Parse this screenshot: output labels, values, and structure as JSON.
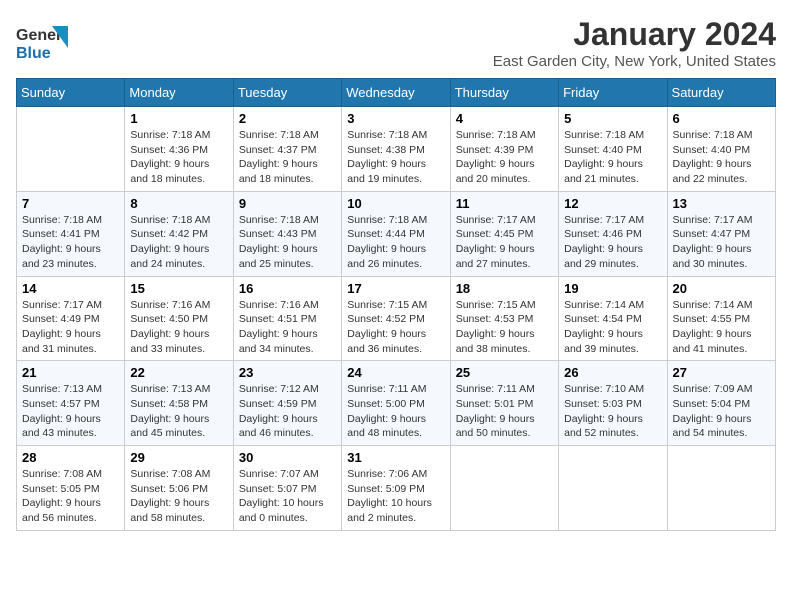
{
  "header": {
    "logo_general": "General",
    "logo_blue": "Blue",
    "title": "January 2024",
    "subtitle": "East Garden City, New York, United States"
  },
  "days_of_week": [
    "Sunday",
    "Monday",
    "Tuesday",
    "Wednesday",
    "Thursday",
    "Friday",
    "Saturday"
  ],
  "weeks": [
    [
      {
        "day": "",
        "sunrise": "",
        "sunset": "",
        "daylight": ""
      },
      {
        "day": "1",
        "sunrise": "Sunrise: 7:18 AM",
        "sunset": "Sunset: 4:36 PM",
        "daylight": "Daylight: 9 hours and 18 minutes."
      },
      {
        "day": "2",
        "sunrise": "Sunrise: 7:18 AM",
        "sunset": "Sunset: 4:37 PM",
        "daylight": "Daylight: 9 hours and 18 minutes."
      },
      {
        "day": "3",
        "sunrise": "Sunrise: 7:18 AM",
        "sunset": "Sunset: 4:38 PM",
        "daylight": "Daylight: 9 hours and 19 minutes."
      },
      {
        "day": "4",
        "sunrise": "Sunrise: 7:18 AM",
        "sunset": "Sunset: 4:39 PM",
        "daylight": "Daylight: 9 hours and 20 minutes."
      },
      {
        "day": "5",
        "sunrise": "Sunrise: 7:18 AM",
        "sunset": "Sunset: 4:40 PM",
        "daylight": "Daylight: 9 hours and 21 minutes."
      },
      {
        "day": "6",
        "sunrise": "Sunrise: 7:18 AM",
        "sunset": "Sunset: 4:40 PM",
        "daylight": "Daylight: 9 hours and 22 minutes."
      }
    ],
    [
      {
        "day": "7",
        "sunrise": "Sunrise: 7:18 AM",
        "sunset": "Sunset: 4:41 PM",
        "daylight": "Daylight: 9 hours and 23 minutes."
      },
      {
        "day": "8",
        "sunrise": "Sunrise: 7:18 AM",
        "sunset": "Sunset: 4:42 PM",
        "daylight": "Daylight: 9 hours and 24 minutes."
      },
      {
        "day": "9",
        "sunrise": "Sunrise: 7:18 AM",
        "sunset": "Sunset: 4:43 PM",
        "daylight": "Daylight: 9 hours and 25 minutes."
      },
      {
        "day": "10",
        "sunrise": "Sunrise: 7:18 AM",
        "sunset": "Sunset: 4:44 PM",
        "daylight": "Daylight: 9 hours and 26 minutes."
      },
      {
        "day": "11",
        "sunrise": "Sunrise: 7:17 AM",
        "sunset": "Sunset: 4:45 PM",
        "daylight": "Daylight: 9 hours and 27 minutes."
      },
      {
        "day": "12",
        "sunrise": "Sunrise: 7:17 AM",
        "sunset": "Sunset: 4:46 PM",
        "daylight": "Daylight: 9 hours and 29 minutes."
      },
      {
        "day": "13",
        "sunrise": "Sunrise: 7:17 AM",
        "sunset": "Sunset: 4:47 PM",
        "daylight": "Daylight: 9 hours and 30 minutes."
      }
    ],
    [
      {
        "day": "14",
        "sunrise": "Sunrise: 7:17 AM",
        "sunset": "Sunset: 4:49 PM",
        "daylight": "Daylight: 9 hours and 31 minutes."
      },
      {
        "day": "15",
        "sunrise": "Sunrise: 7:16 AM",
        "sunset": "Sunset: 4:50 PM",
        "daylight": "Daylight: 9 hours and 33 minutes."
      },
      {
        "day": "16",
        "sunrise": "Sunrise: 7:16 AM",
        "sunset": "Sunset: 4:51 PM",
        "daylight": "Daylight: 9 hours and 34 minutes."
      },
      {
        "day": "17",
        "sunrise": "Sunrise: 7:15 AM",
        "sunset": "Sunset: 4:52 PM",
        "daylight": "Daylight: 9 hours and 36 minutes."
      },
      {
        "day": "18",
        "sunrise": "Sunrise: 7:15 AM",
        "sunset": "Sunset: 4:53 PM",
        "daylight": "Daylight: 9 hours and 38 minutes."
      },
      {
        "day": "19",
        "sunrise": "Sunrise: 7:14 AM",
        "sunset": "Sunset: 4:54 PM",
        "daylight": "Daylight: 9 hours and 39 minutes."
      },
      {
        "day": "20",
        "sunrise": "Sunrise: 7:14 AM",
        "sunset": "Sunset: 4:55 PM",
        "daylight": "Daylight: 9 hours and 41 minutes."
      }
    ],
    [
      {
        "day": "21",
        "sunrise": "Sunrise: 7:13 AM",
        "sunset": "Sunset: 4:57 PM",
        "daylight": "Daylight: 9 hours and 43 minutes."
      },
      {
        "day": "22",
        "sunrise": "Sunrise: 7:13 AM",
        "sunset": "Sunset: 4:58 PM",
        "daylight": "Daylight: 9 hours and 45 minutes."
      },
      {
        "day": "23",
        "sunrise": "Sunrise: 7:12 AM",
        "sunset": "Sunset: 4:59 PM",
        "daylight": "Daylight: 9 hours and 46 minutes."
      },
      {
        "day": "24",
        "sunrise": "Sunrise: 7:11 AM",
        "sunset": "Sunset: 5:00 PM",
        "daylight": "Daylight: 9 hours and 48 minutes."
      },
      {
        "day": "25",
        "sunrise": "Sunrise: 7:11 AM",
        "sunset": "Sunset: 5:01 PM",
        "daylight": "Daylight: 9 hours and 50 minutes."
      },
      {
        "day": "26",
        "sunrise": "Sunrise: 7:10 AM",
        "sunset": "Sunset: 5:03 PM",
        "daylight": "Daylight: 9 hours and 52 minutes."
      },
      {
        "day": "27",
        "sunrise": "Sunrise: 7:09 AM",
        "sunset": "Sunset: 5:04 PM",
        "daylight": "Daylight: 9 hours and 54 minutes."
      }
    ],
    [
      {
        "day": "28",
        "sunrise": "Sunrise: 7:08 AM",
        "sunset": "Sunset: 5:05 PM",
        "daylight": "Daylight: 9 hours and 56 minutes."
      },
      {
        "day": "29",
        "sunrise": "Sunrise: 7:08 AM",
        "sunset": "Sunset: 5:06 PM",
        "daylight": "Daylight: 9 hours and 58 minutes."
      },
      {
        "day": "30",
        "sunrise": "Sunrise: 7:07 AM",
        "sunset": "Sunset: 5:07 PM",
        "daylight": "Daylight: 10 hours and 0 minutes."
      },
      {
        "day": "31",
        "sunrise": "Sunrise: 7:06 AM",
        "sunset": "Sunset: 5:09 PM",
        "daylight": "Daylight: 10 hours and 2 minutes."
      },
      {
        "day": "",
        "sunrise": "",
        "sunset": "",
        "daylight": ""
      },
      {
        "day": "",
        "sunrise": "",
        "sunset": "",
        "daylight": ""
      },
      {
        "day": "",
        "sunrise": "",
        "sunset": "",
        "daylight": ""
      }
    ]
  ]
}
